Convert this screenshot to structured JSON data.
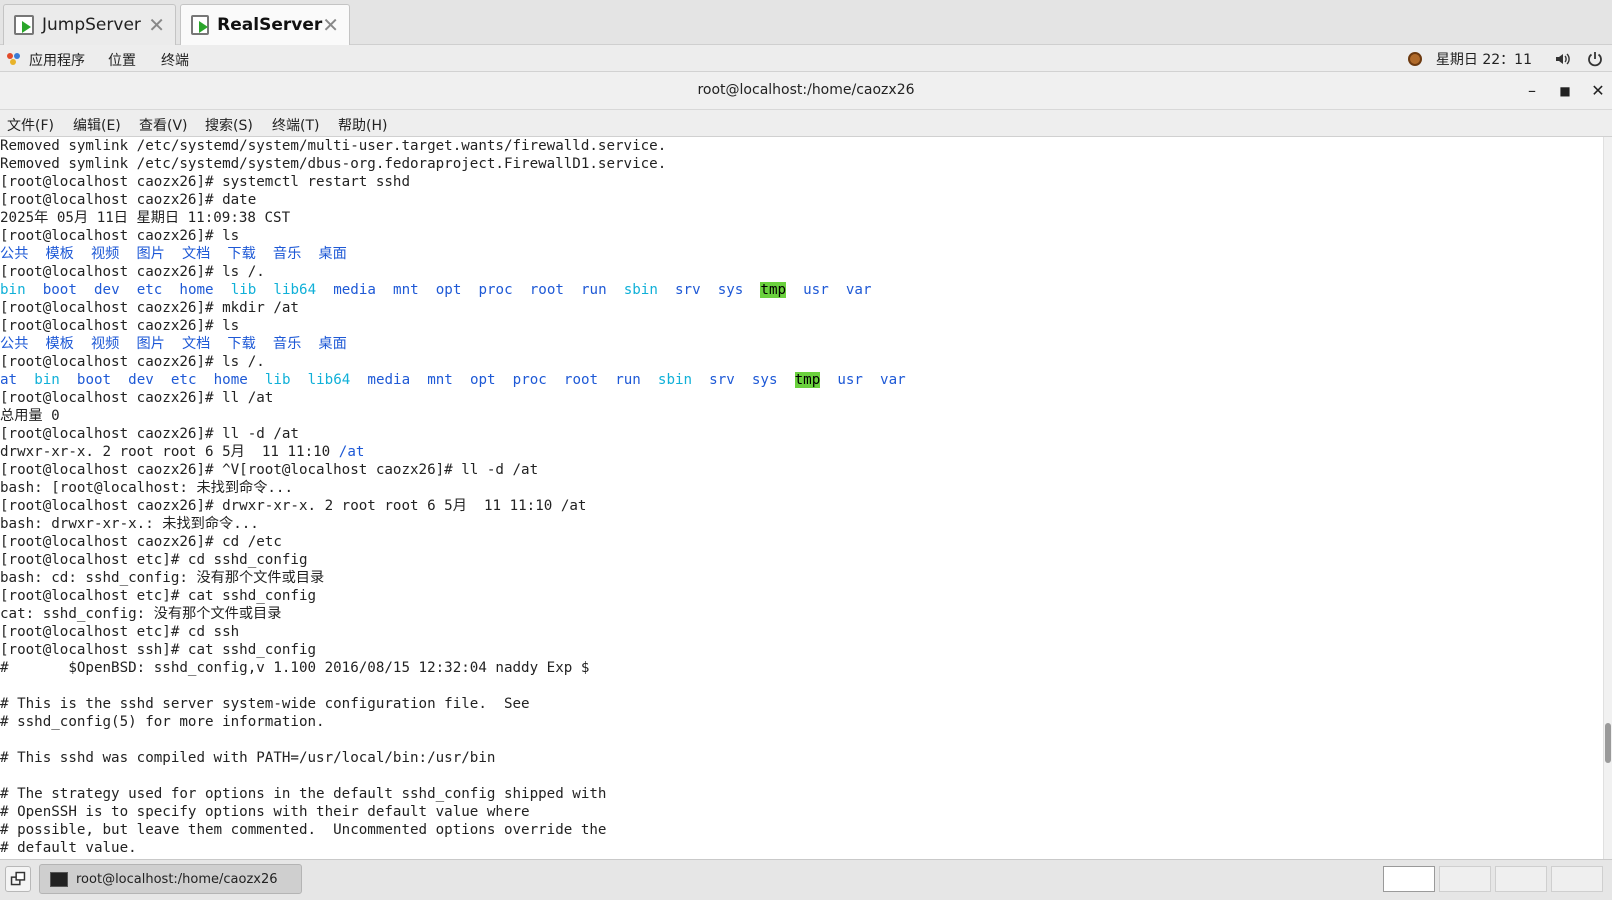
{
  "tabs": [
    {
      "label": "JumpServer"
    },
    {
      "label": "RealServer"
    }
  ],
  "top_bar": {
    "menu": [
      "应用程序",
      "位置",
      "终端"
    ],
    "clock": "星期日 22：11"
  },
  "window": {
    "title": "root@localhost:/home/caozx26"
  },
  "menubar": [
    "文件(F)",
    "编辑(E)",
    "查看(V)",
    "搜索(S)",
    "终端(T)",
    "帮助(H)"
  ],
  "terminal": {
    "lines": [
      [
        {
          "t": "Removed symlink /etc/systemd/system/multi-user.target.wants/firewalld.service."
        }
      ],
      [
        {
          "t": "Removed symlink /etc/systemd/system/dbus-org.fedoraproject.FirewallD1.service."
        }
      ],
      [
        {
          "t": "[root@localhost caozx26]# systemctl restart sshd"
        }
      ],
      [
        {
          "t": "[root@localhost caozx26]# date"
        }
      ],
      [
        {
          "t": "2025年 05月 11日 星期日 11:09:38 CST"
        }
      ],
      [
        {
          "t": "[root@localhost caozx26]# ls"
        }
      ],
      [
        {
          "t": "公共",
          "c": "dir"
        },
        {
          "t": "  "
        },
        {
          "t": "模板",
          "c": "dir"
        },
        {
          "t": "  "
        },
        {
          "t": "视频",
          "c": "dir"
        },
        {
          "t": "  "
        },
        {
          "t": "图片",
          "c": "dir"
        },
        {
          "t": "  "
        },
        {
          "t": "文档",
          "c": "dir"
        },
        {
          "t": "  "
        },
        {
          "t": "下载",
          "c": "dir"
        },
        {
          "t": "  "
        },
        {
          "t": "音乐",
          "c": "dir"
        },
        {
          "t": "  "
        },
        {
          "t": "桌面",
          "c": "dir"
        }
      ],
      [
        {
          "t": "[root@localhost caozx26]# ls /."
        }
      ],
      [
        {
          "t": "bin",
          "c": "lnk"
        },
        {
          "t": "  "
        },
        {
          "t": "boot",
          "c": "dir"
        },
        {
          "t": "  "
        },
        {
          "t": "dev",
          "c": "dir"
        },
        {
          "t": "  "
        },
        {
          "t": "etc",
          "c": "dir"
        },
        {
          "t": "  "
        },
        {
          "t": "home",
          "c": "dir"
        },
        {
          "t": "  "
        },
        {
          "t": "lib",
          "c": "lnk"
        },
        {
          "t": "  "
        },
        {
          "t": "lib64",
          "c": "lnk"
        },
        {
          "t": "  "
        },
        {
          "t": "media",
          "c": "dir"
        },
        {
          "t": "  "
        },
        {
          "t": "mnt",
          "c": "dir"
        },
        {
          "t": "  "
        },
        {
          "t": "opt",
          "c": "dir"
        },
        {
          "t": "  "
        },
        {
          "t": "proc",
          "c": "dir"
        },
        {
          "t": "  "
        },
        {
          "t": "root",
          "c": "dir"
        },
        {
          "t": "  "
        },
        {
          "t": "run",
          "c": "dir"
        },
        {
          "t": "  "
        },
        {
          "t": "sbin",
          "c": "lnk"
        },
        {
          "t": "  "
        },
        {
          "t": "srv",
          "c": "dir"
        },
        {
          "t": "  "
        },
        {
          "t": "sys",
          "c": "dir"
        },
        {
          "t": "  "
        },
        {
          "t": "tmp",
          "c": "hl"
        },
        {
          "t": "  "
        },
        {
          "t": "usr",
          "c": "dir"
        },
        {
          "t": "  "
        },
        {
          "t": "var",
          "c": "dir"
        }
      ],
      [
        {
          "t": "[root@localhost caozx26]# mkdir /at"
        }
      ],
      [
        {
          "t": "[root@localhost caozx26]# ls"
        }
      ],
      [
        {
          "t": "公共",
          "c": "dir"
        },
        {
          "t": "  "
        },
        {
          "t": "模板",
          "c": "dir"
        },
        {
          "t": "  "
        },
        {
          "t": "视频",
          "c": "dir"
        },
        {
          "t": "  "
        },
        {
          "t": "图片",
          "c": "dir"
        },
        {
          "t": "  "
        },
        {
          "t": "文档",
          "c": "dir"
        },
        {
          "t": "  "
        },
        {
          "t": "下载",
          "c": "dir"
        },
        {
          "t": "  "
        },
        {
          "t": "音乐",
          "c": "dir"
        },
        {
          "t": "  "
        },
        {
          "t": "桌面",
          "c": "dir"
        }
      ],
      [
        {
          "t": "[root@localhost caozx26]# ls /."
        }
      ],
      [
        {
          "t": "at",
          "c": "dir"
        },
        {
          "t": "  "
        },
        {
          "t": "bin",
          "c": "lnk"
        },
        {
          "t": "  "
        },
        {
          "t": "boot",
          "c": "dir"
        },
        {
          "t": "  "
        },
        {
          "t": "dev",
          "c": "dir"
        },
        {
          "t": "  "
        },
        {
          "t": "etc",
          "c": "dir"
        },
        {
          "t": "  "
        },
        {
          "t": "home",
          "c": "dir"
        },
        {
          "t": "  "
        },
        {
          "t": "lib",
          "c": "lnk"
        },
        {
          "t": "  "
        },
        {
          "t": "lib64",
          "c": "lnk"
        },
        {
          "t": "  "
        },
        {
          "t": "media",
          "c": "dir"
        },
        {
          "t": "  "
        },
        {
          "t": "mnt",
          "c": "dir"
        },
        {
          "t": "  "
        },
        {
          "t": "opt",
          "c": "dir"
        },
        {
          "t": "  "
        },
        {
          "t": "proc",
          "c": "dir"
        },
        {
          "t": "  "
        },
        {
          "t": "root",
          "c": "dir"
        },
        {
          "t": "  "
        },
        {
          "t": "run",
          "c": "dir"
        },
        {
          "t": "  "
        },
        {
          "t": "sbin",
          "c": "lnk"
        },
        {
          "t": "  "
        },
        {
          "t": "srv",
          "c": "dir"
        },
        {
          "t": "  "
        },
        {
          "t": "sys",
          "c": "dir"
        },
        {
          "t": "  "
        },
        {
          "t": "tmp",
          "c": "hl"
        },
        {
          "t": "  "
        },
        {
          "t": "usr",
          "c": "dir"
        },
        {
          "t": "  "
        },
        {
          "t": "var",
          "c": "dir"
        }
      ],
      [
        {
          "t": "[root@localhost caozx26]# ll /at"
        }
      ],
      [
        {
          "t": "总用量 0"
        }
      ],
      [
        {
          "t": "[root@localhost caozx26]# ll -d /at"
        }
      ],
      [
        {
          "t": "drwxr-xr-x. 2 root root 6 5月  11 11:10 "
        },
        {
          "t": "/at",
          "c": "dir"
        }
      ],
      [
        {
          "t": "[root@localhost caozx26]# ^V[root@localhost caozx26]# ll -d /at"
        }
      ],
      [
        {
          "t": "bash: [root@localhost: 未找到命令..."
        }
      ],
      [
        {
          "t": "[root@localhost caozx26]# drwxr-xr-x. 2 root root 6 5月  11 11:10 /at"
        }
      ],
      [
        {
          "t": "bash: drwxr-xr-x.: 未找到命令..."
        }
      ],
      [
        {
          "t": "[root@localhost caozx26]# cd /etc"
        }
      ],
      [
        {
          "t": "[root@localhost etc]# cd sshd_config"
        }
      ],
      [
        {
          "t": "bash: cd: sshd_config: 没有那个文件或目录"
        }
      ],
      [
        {
          "t": "[root@localhost etc]# cat sshd_config"
        }
      ],
      [
        {
          "t": "cat: sshd_config: 没有那个文件或目录"
        }
      ],
      [
        {
          "t": "[root@localhost etc]# cd ssh"
        }
      ],
      [
        {
          "t": "[root@localhost ssh]# cat sshd_config"
        }
      ],
      [
        {
          "t": "#       $OpenBSD: sshd_config,v 1.100 2016/08/15 12:32:04 naddy Exp $"
        }
      ],
      [
        {
          "t": ""
        }
      ],
      [
        {
          "t": "# This is the sshd server system-wide configuration file.  See"
        }
      ],
      [
        {
          "t": "# sshd_config(5) for more information."
        }
      ],
      [
        {
          "t": ""
        }
      ],
      [
        {
          "t": "# This sshd was compiled with PATH=/usr/local/bin:/usr/bin"
        }
      ],
      [
        {
          "t": ""
        }
      ],
      [
        {
          "t": "# The strategy used for options in the default sshd_config shipped with"
        }
      ],
      [
        {
          "t": "# OpenSSH is to specify options with their default value where"
        }
      ],
      [
        {
          "t": "# possible, but leave them commented.  Uncommented options override the"
        }
      ],
      [
        {
          "t": "# default value."
        }
      ]
    ]
  },
  "taskbar": {
    "task_label": "root@localhost:/home/caozx26"
  },
  "colors": {
    "directory": "#1e59d6",
    "symlink": "#10b0d8",
    "sticky_dir_bg": "#6ad13d"
  }
}
